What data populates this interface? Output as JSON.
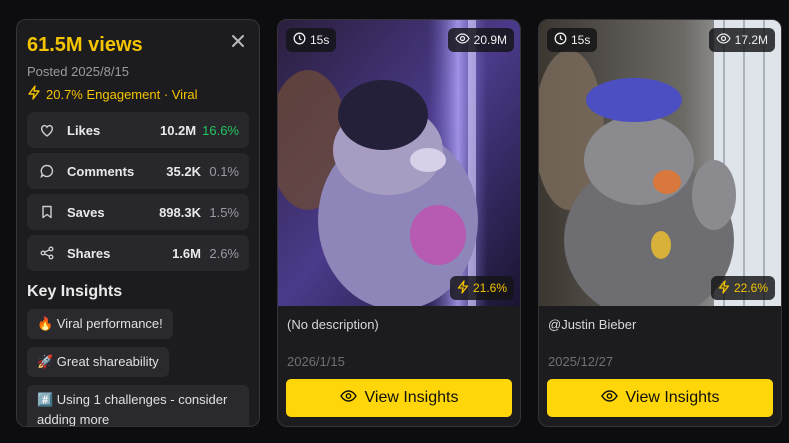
{
  "panel": {
    "views": "61.5M views",
    "posted": "Posted 2025/8/15",
    "engagement": "20.7% Engagement · Viral",
    "stats": [
      {
        "label": "Likes",
        "value": "10.2M",
        "pct": "16.6%",
        "icon": "heart-icon"
      },
      {
        "label": "Comments",
        "value": "35.2K",
        "pct": "0.1%",
        "icon": "comment-icon"
      },
      {
        "label": "Saves",
        "value": "898.3K",
        "pct": "1.5%",
        "icon": "bookmark-icon"
      },
      {
        "label": "Shares",
        "value": "1.6M",
        "pct": "2.6%",
        "icon": "share-icon"
      }
    ],
    "insights_title": "Key Insights",
    "insights": [
      "🔥 Viral performance!",
      "🚀 Great shareability",
      "#️⃣ Using 1 challenges - consider adding more"
    ]
  },
  "videos": [
    {
      "duration": "15s",
      "views": "20.9M",
      "engagement": "21.6%",
      "description": "(No description)",
      "date": "2026/1/15",
      "button": "View Insights"
    },
    {
      "duration": "15s",
      "views": "17.2M",
      "engagement": "22.6%",
      "description": "@Justin Bieber",
      "date": "2025/12/27",
      "button": "View Insights"
    }
  ],
  "colors": {
    "accent": "#f5c400",
    "button": "#ffd60a",
    "positive": "#22c55e",
    "background": "#0d0d0f",
    "card": "#1c1c1f"
  }
}
